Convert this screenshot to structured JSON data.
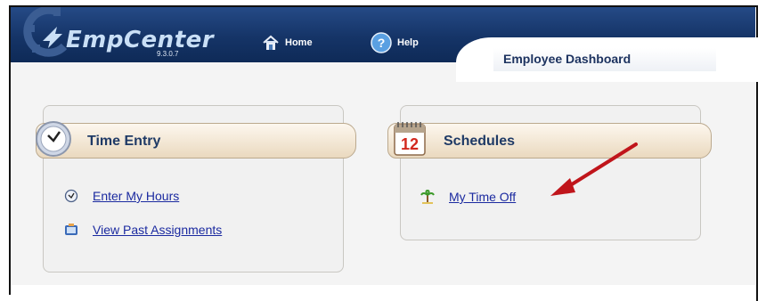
{
  "app": {
    "logo_text": "EmpCenter",
    "version": "9.3.0.7",
    "dashboard_title": "Employee Dashboard"
  },
  "nav": {
    "home_label": "Home",
    "help_label": "Help"
  },
  "panels": [
    {
      "title": "Time Entry",
      "icon": "clock-icon",
      "links": [
        {
          "label": "Enter My Hours",
          "icon": "small-clock-icon"
        },
        {
          "label": "View Past Assignments",
          "icon": "assignments-icon"
        }
      ]
    },
    {
      "title": "Schedules",
      "icon": "calendar-icon",
      "calendar_day": "12",
      "links": [
        {
          "label": "My Time Off",
          "icon": "palm-tree-icon"
        }
      ]
    }
  ],
  "colors": {
    "header_blue": "#153467",
    "link_blue": "#1b2aa0",
    "annotation_red": "#c0151b"
  }
}
